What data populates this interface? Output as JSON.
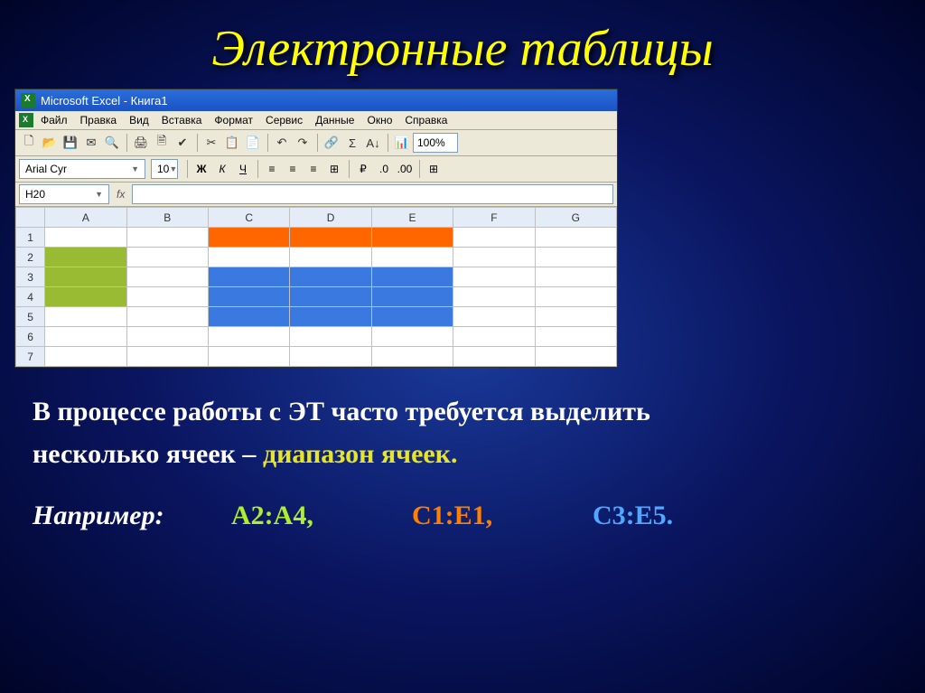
{
  "slide": {
    "title": "Электронные таблицы"
  },
  "excel": {
    "window_title": "Microsoft Excel - Книга1",
    "menus": [
      "Файл",
      "Правка",
      "Вид",
      "Вставка",
      "Формат",
      "Сервис",
      "Данные",
      "Окно",
      "Справка"
    ],
    "font_name": "Arial Cyr",
    "font_size": "10",
    "bold": "Ж",
    "italic": "К",
    "underline": "Ч",
    "zoom": "100%",
    "cell_ref": "H20",
    "fx": "fx",
    "columns": [
      "A",
      "B",
      "C",
      "D",
      "E",
      "F",
      "G"
    ],
    "rows": [
      "1",
      "2",
      "3",
      "4",
      "5",
      "6",
      "7"
    ],
    "colored": {
      "A2": "green",
      "A3": "green",
      "A4": "green",
      "C1": "orange",
      "D1": "orange",
      "E1": "orange",
      "C3": "blue",
      "D3": "blue",
      "E3": "blue",
      "C4": "blue",
      "D4": "blue",
      "E4": "blue",
      "C5": "blue",
      "D5": "blue",
      "E5": "blue"
    }
  },
  "desc": {
    "line1": "В процессе работы с ЭТ часто требуется выделить",
    "line2_prefix": "несколько ячеек – ",
    "line2_accent": "диапазон ячеек."
  },
  "examples": {
    "label": "Например:",
    "r_green": "A2:A4,",
    "r_orange": "C1:E1,",
    "r_blue": "C3:E5."
  }
}
